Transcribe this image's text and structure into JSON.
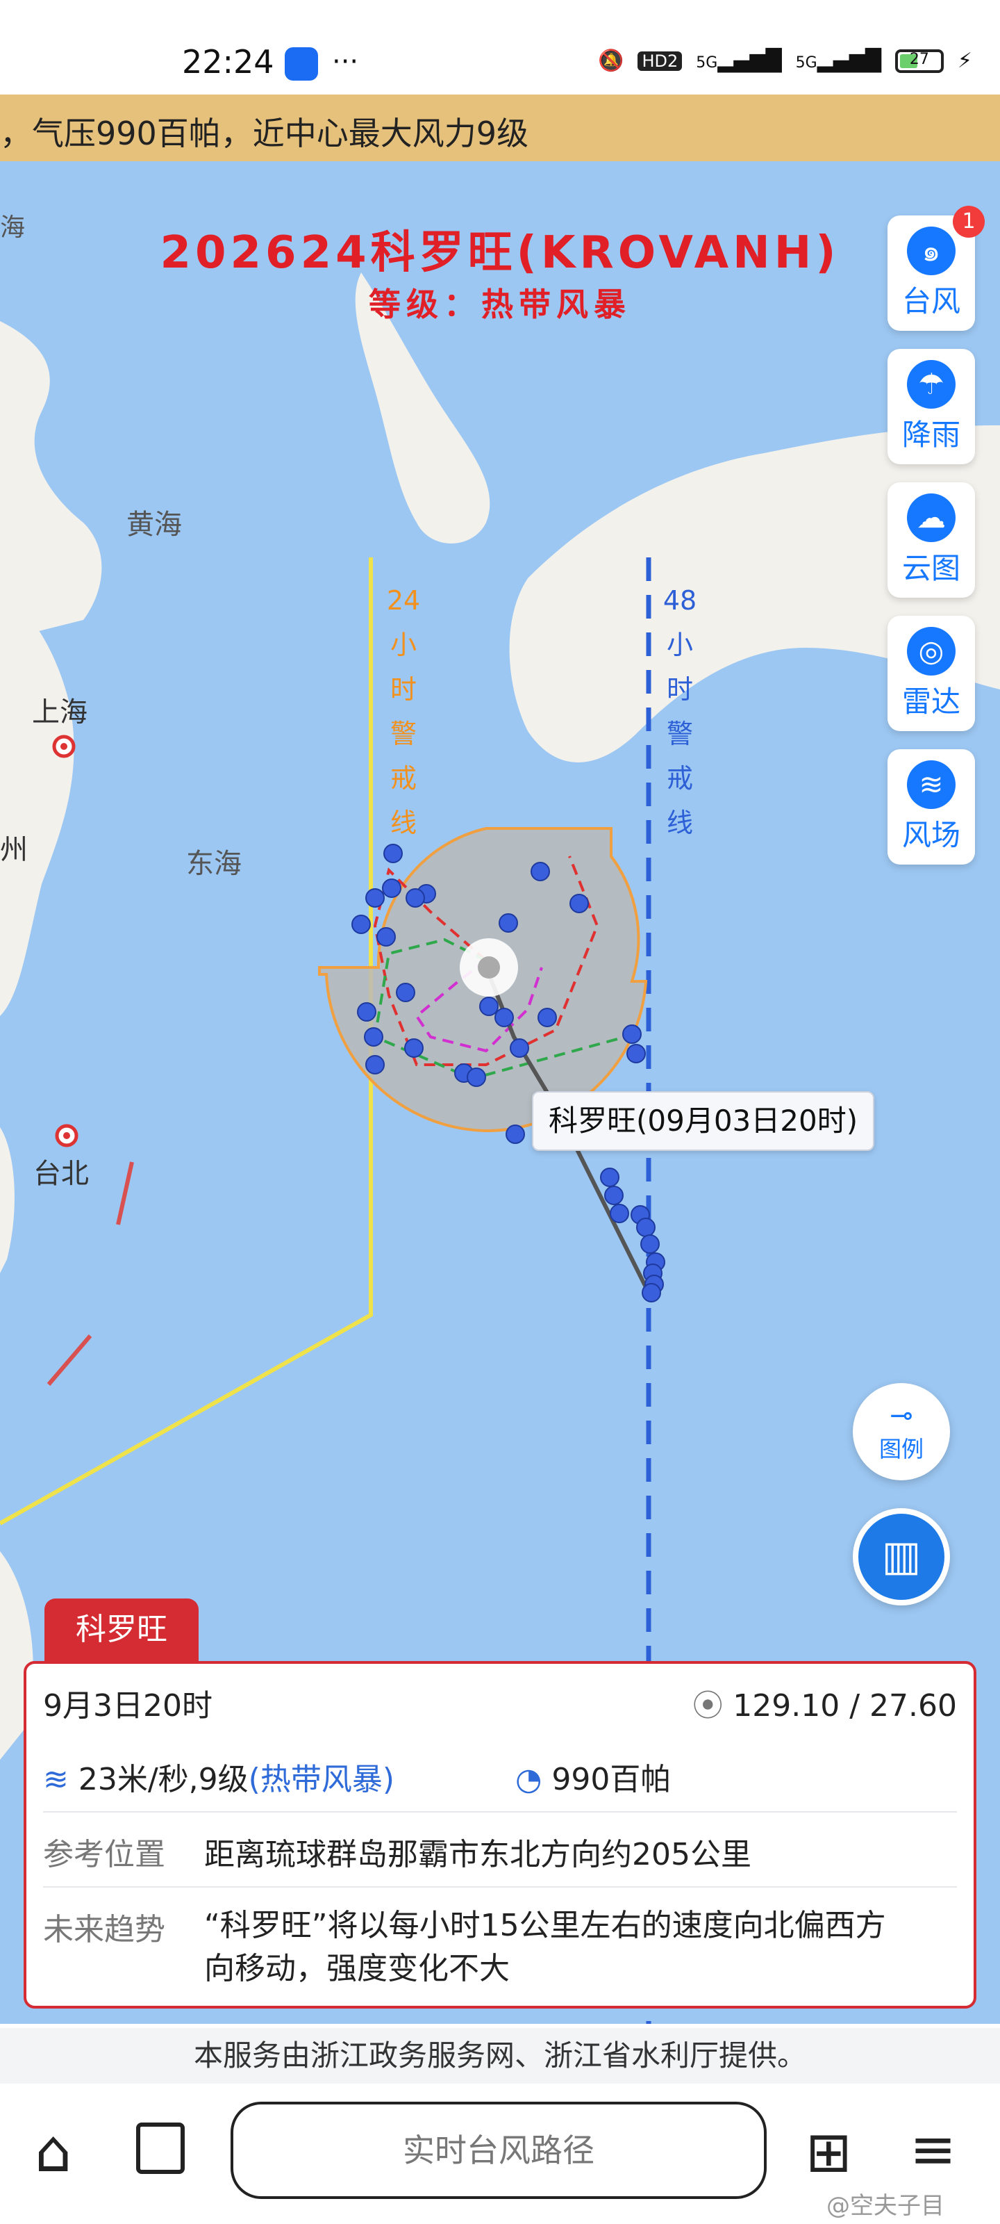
{
  "status_bar": {
    "time": "22:24",
    "hd_label": "HD2",
    "signal1": "5G",
    "signal2": "5G",
    "battery": "27"
  },
  "banner": {
    "text": "，气压990百帕，近中心最大风力9级"
  },
  "map": {
    "title": "202624科罗旺(KROVANH)",
    "subtitle": "等级：热带风暴",
    "labels": {
      "yellow_sea": "黄海",
      "east_sea": "东海",
      "shanghai": "上海",
      "taibei": "台北",
      "zhou": "州",
      "hai": "海"
    },
    "line24": [
      "24",
      "小",
      "时",
      "警",
      "戒",
      "线"
    ],
    "line48": [
      "48",
      "小",
      "时",
      "警",
      "戒",
      "线"
    ],
    "callout": "科罗旺(09月03日20时)",
    "side_buttons": [
      {
        "label": "台风",
        "icon": "typhoon-icon"
      },
      {
        "label": "降雨",
        "icon": "rain-icon"
      },
      {
        "label": "云图",
        "icon": "cloud-icon"
      },
      {
        "label": "雷达",
        "icon": "radar-icon"
      },
      {
        "label": "风场",
        "icon": "wind-icon"
      }
    ],
    "badge": "1",
    "legend_label": "图例"
  },
  "info": {
    "tab": "科罗旺",
    "time": "9月3日20时",
    "coords": "129.10 / 27.60",
    "wind": "23米/秒,9级",
    "wind_level": "(热带风暴)",
    "pressure": "990百帕",
    "ref_label": "参考位置",
    "ref_value": "距离琉球群岛那霸市东北方向约205公里",
    "trend_label": "未来趋势",
    "trend_value1": "“科罗旺”将以每小时15公里左右的速度向北偏西方",
    "trend_value2": "向移动，强度变化不大"
  },
  "footer_note": "本服务由浙江政务服务网、浙江省水利厅提供。",
  "bottom": {
    "search": "实时台风路径",
    "watermark": "@空夫子目"
  }
}
